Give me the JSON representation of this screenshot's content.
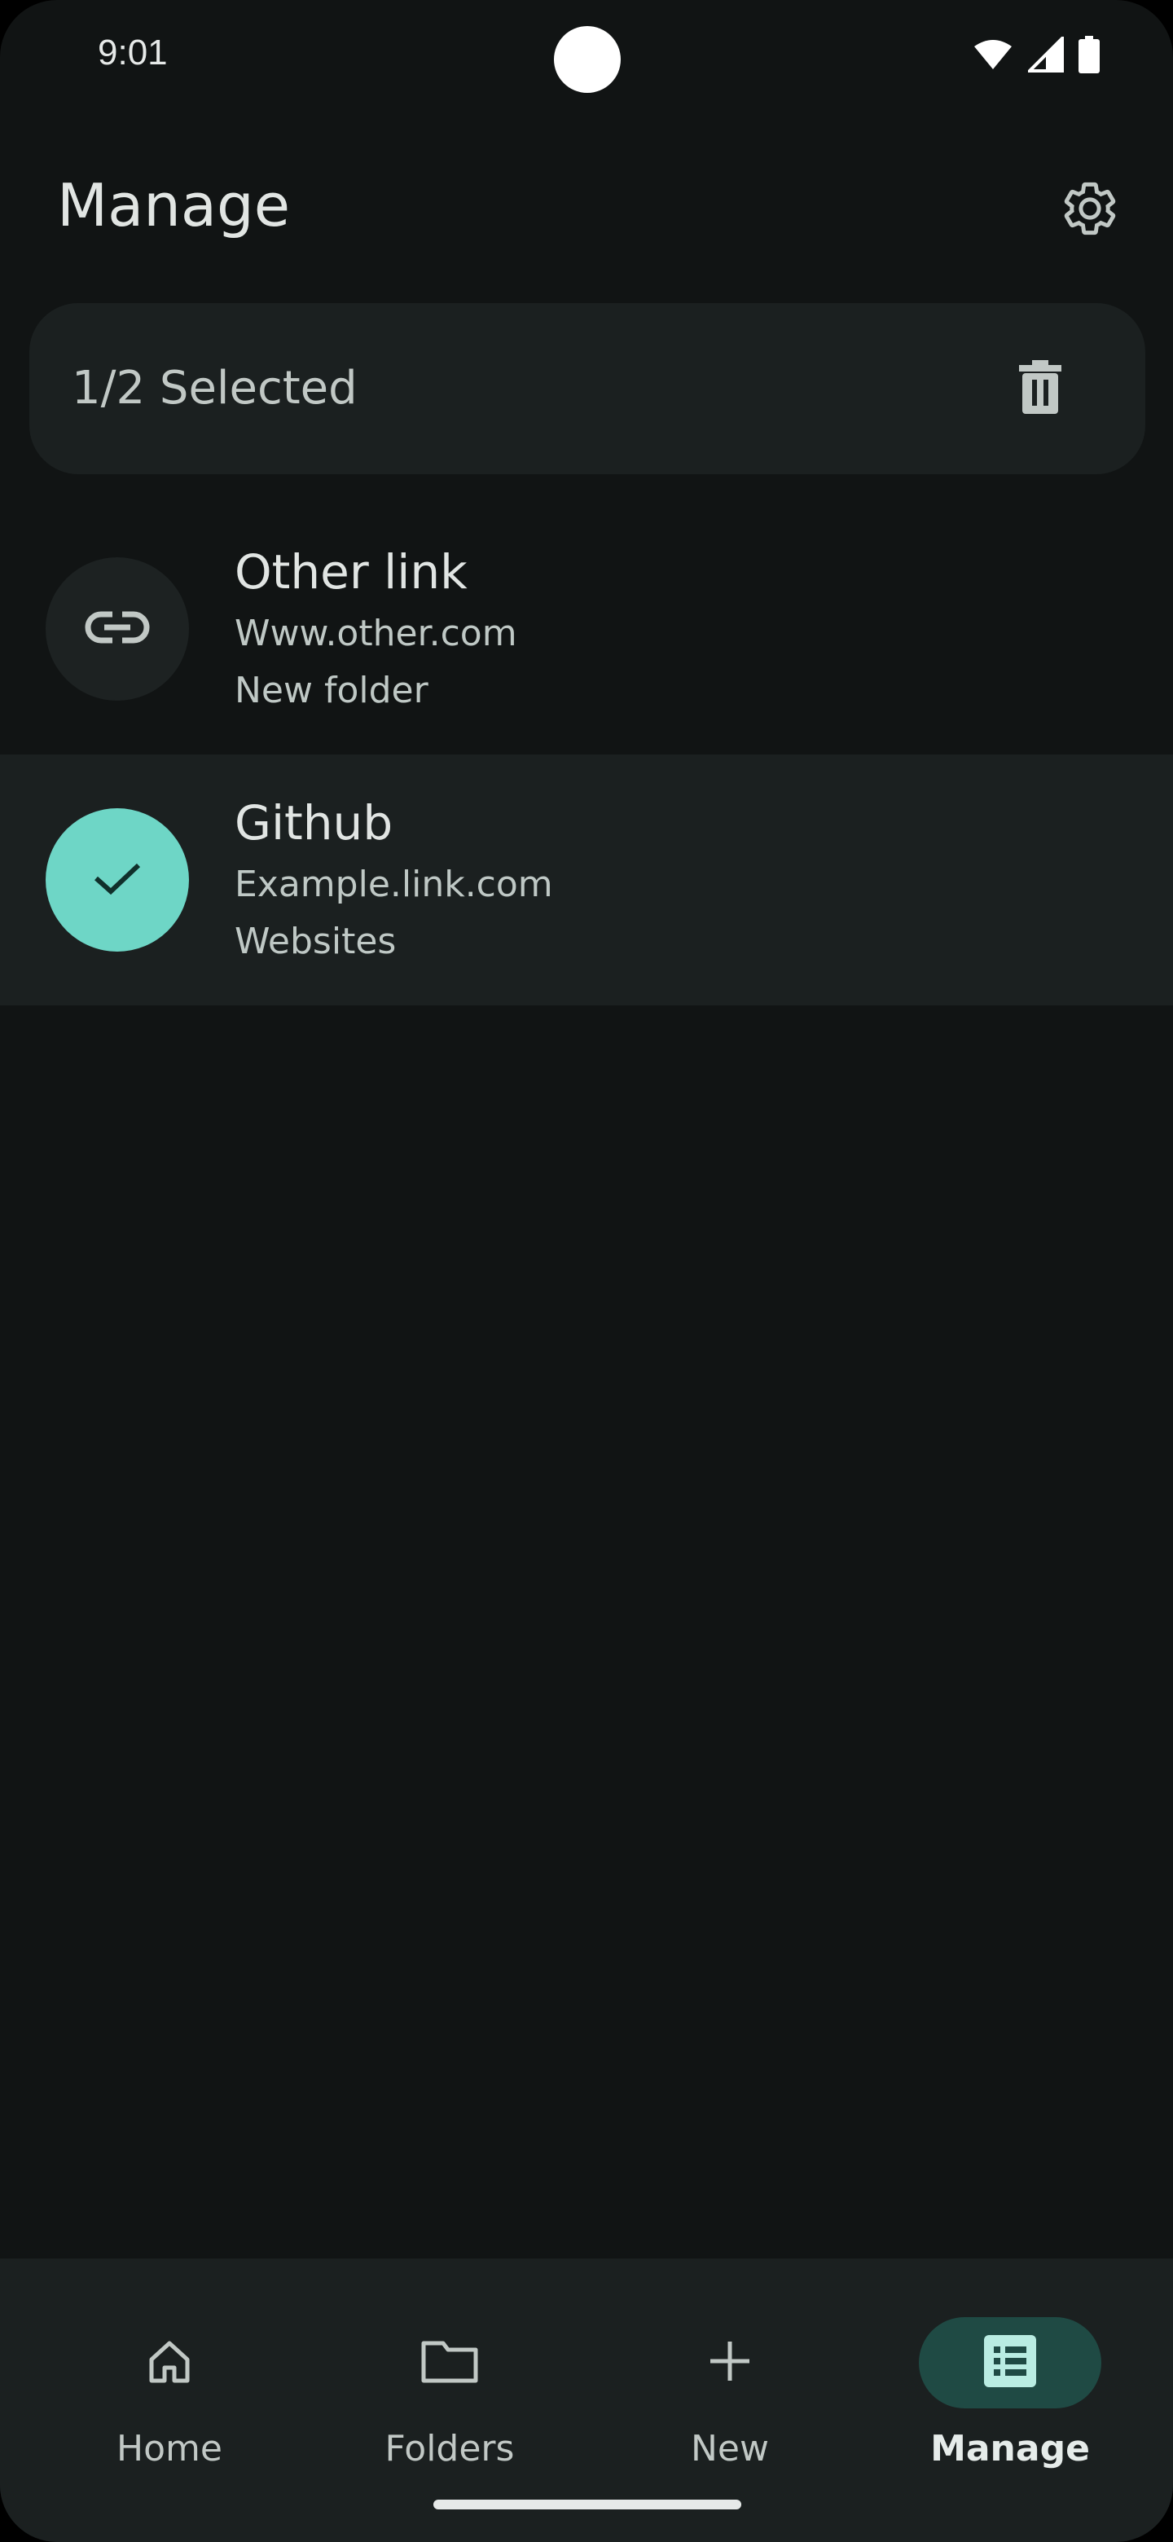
{
  "status_bar": {
    "time": "9:01"
  },
  "header": {
    "title": "Manage"
  },
  "selection": {
    "text": "1/2 Selected"
  },
  "links": [
    {
      "title": "Other link",
      "url": "Www.other.com",
      "folder": "New folder",
      "selected": false
    },
    {
      "title": "Github",
      "url": "Example.link.com",
      "folder": "Websites",
      "selected": true
    }
  ],
  "nav": {
    "items": [
      {
        "label": "Home",
        "icon": "home-icon",
        "active": false
      },
      {
        "label": "Folders",
        "icon": "folder-icon",
        "active": false
      },
      {
        "label": "New",
        "icon": "plus-icon",
        "active": false
      },
      {
        "label": "Manage",
        "icon": "list-icon",
        "active": true
      }
    ]
  },
  "colors": {
    "background": "#111414",
    "surface": "#1b2020",
    "accent": "#6ed6c6",
    "active_pill": "#1f4a44"
  }
}
